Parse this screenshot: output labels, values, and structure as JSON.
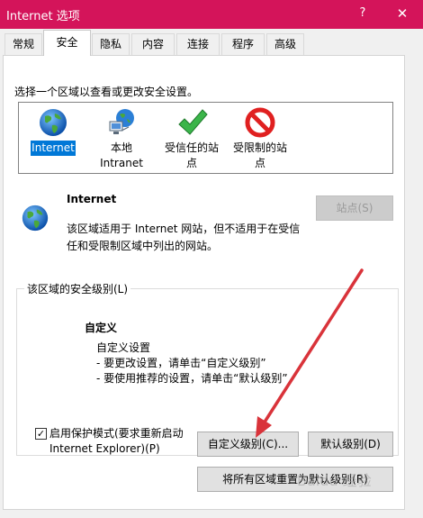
{
  "window": {
    "title": "Internet 选项",
    "help_glyph": "?",
    "close_glyph": "✕"
  },
  "tabs": [
    {
      "label": "常规"
    },
    {
      "label": "安全"
    },
    {
      "label": "隐私"
    },
    {
      "label": "内容"
    },
    {
      "label": "连接"
    },
    {
      "label": "程序"
    },
    {
      "label": "高级"
    }
  ],
  "active_tab": "安全",
  "security": {
    "zone_prompt": "选择一个区域以查看或更改安全设置。",
    "zones": [
      {
        "label": "Internet",
        "icon": "globe-icon",
        "selected": true
      },
      {
        "label_line1": "本地",
        "label_line2": "Intranet",
        "icon": "intranet-icon"
      },
      {
        "label_line1": "受信任的站",
        "label_line2": "点",
        "icon": "trusted-check-icon"
      },
      {
        "label_line1": "受限制的站",
        "label_line2": "点",
        "icon": "restricted-icon"
      }
    ],
    "zone_title": "Internet",
    "zone_desc": "该区域适用于 Internet 网站，但不适用于在受信任和受限制区域中列出的网站。",
    "sites_button": "站点(S)",
    "level_group_title": "该区域的安全级别(L)",
    "level_name": "自定义",
    "level_lines": [
      "自定义设置",
      "- 要更改设置，请单击“自定义级别”",
      "- 要使用推荐的设置，请单击“默认级别”"
    ],
    "protected_mode_label": "启用保护模式(要求重新启动 Internet Explorer)(P)",
    "protected_mode_checked": true,
    "custom_level_button": "自定义级别(C)...",
    "default_level_button": "默认级别(D)",
    "reset_all_button": "将所有区域重置为默认级别(R)"
  },
  "colors": {
    "titlebar": "#d4145a",
    "selection": "#0078d7",
    "arrow": "#d9333a"
  },
  "watermark": "Baidu 经验"
}
